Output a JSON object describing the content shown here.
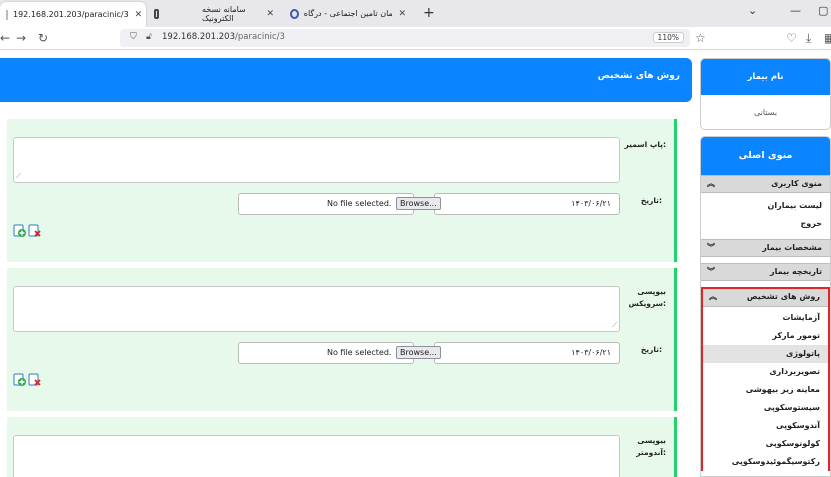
{
  "browser": {
    "tabs": [
      {
        "label": "192.168.201.203/paracinic/3",
        "active": true
      },
      {
        "label": "",
        "active": false
      },
      {
        "label": "سامانه نسخه الکترونیک",
        "active": false
      },
      {
        "label": "سازمان تامین اجتماعی - درگاه ...",
        "active": false
      }
    ],
    "url_host": "192.168.201.203",
    "url_path": "/paracinic/3",
    "zoom": "110%"
  },
  "main": {
    "title": "روش های تشخیص",
    "date_label": "تاریخ:",
    "sections": [
      {
        "label": "پاپ اسمیر:",
        "date": "۱۴۰۳/۰۶/۲۱",
        "file_text": "No file selected.",
        "browse": "Browse..."
      },
      {
        "label": "بیوپسی سرویکس:",
        "date": "۱۴۰۳/۰۶/۲۱",
        "file_text": "No file selected.",
        "browse": "Browse..."
      },
      {
        "label": "بیوپسی آندومتر:"
      }
    ]
  },
  "sidebar": {
    "patient_header": "نام بیمار",
    "patient_name": "بستانی",
    "menu_header": "منوی اصلی",
    "groups": [
      {
        "label": "منوی کاربری",
        "items": [
          "لیست بیماران",
          "خروج"
        ]
      },
      {
        "label": "مشخصات بیمار"
      },
      {
        "label": "تاریخچه بیمار"
      },
      {
        "label": "روش های تشخیص",
        "items": [
          "آزمایشات",
          "تومور مارکر",
          "پاتولوژی",
          "تصویربرداری",
          "معاینه زیر بیهوشی",
          "سیستوسکوپی",
          "آندوسکوپی",
          "کولونوسکوپی",
          "رکتوسیگموئیدوسکوپی"
        ]
      }
    ]
  },
  "colors": {
    "accent": "#0a84ff",
    "section_bg": "#e6f9ea",
    "section_border": "#22d36c",
    "highlight": "#e0262a"
  }
}
